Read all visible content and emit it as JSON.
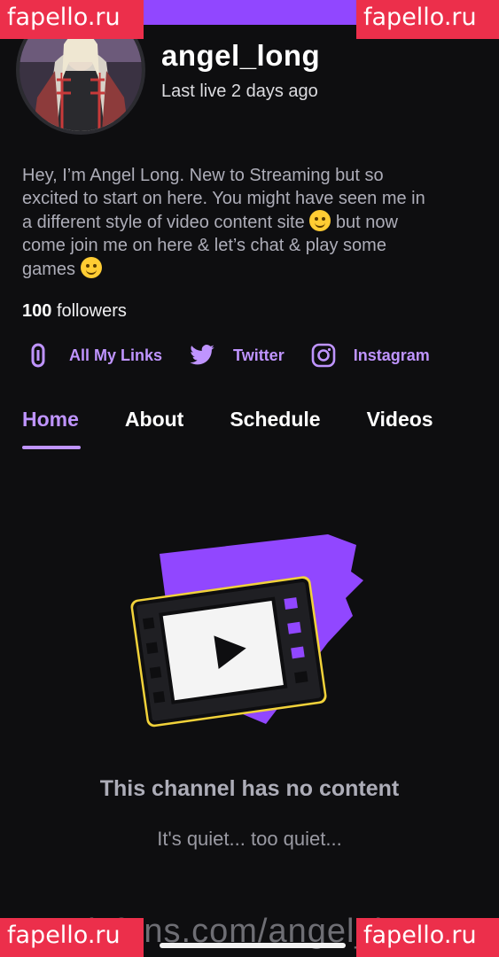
{
  "watermark": {
    "text": "fapello.ru"
  },
  "profile": {
    "username": "angel_long",
    "last_live": "Last live 2 days ago",
    "bio": [
      "Hey, I’m Angel Long. New to Streaming but so",
      "excited to start on here. You might have seen me in",
      "a different style of video content site",
      "but now",
      "come join me on here & let’s chat & play some",
      "games"
    ],
    "followers_count": "100",
    "followers_label": "followers"
  },
  "links": [
    {
      "label": "All My Links",
      "icon": "link-icon"
    },
    {
      "label": "Twitter",
      "icon": "twitter-icon"
    },
    {
      "label": "Instagram",
      "icon": "instagram-icon"
    }
  ],
  "tabs": [
    {
      "label": "Home",
      "active": true
    },
    {
      "label": "About",
      "active": false
    },
    {
      "label": "Schedule",
      "active": false
    },
    {
      "label": "Videos",
      "active": false
    }
  ],
  "empty_state": {
    "title": "This channel has no content",
    "subtitle": "It's quiet... too quiet..."
  },
  "footer": {
    "url_text": "onlyfans.com/angel_long"
  },
  "colors": {
    "accent": "#bf94ff",
    "brand": "#9147ff",
    "background": "#0e0e10",
    "watermark": "#ec2f4b"
  }
}
